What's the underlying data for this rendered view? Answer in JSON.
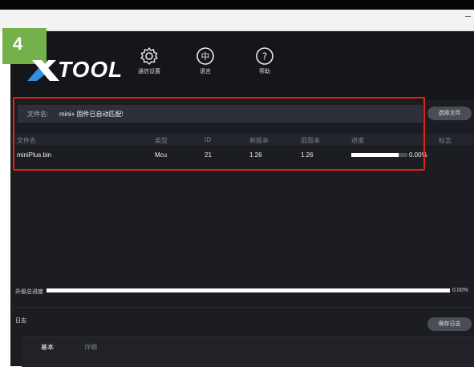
{
  "step_badge": "4",
  "app": {
    "logo_text": "TOOL",
    "toolbar": [
      {
        "label": "通信设置",
        "icon": "gear-icon"
      },
      {
        "label": "语言",
        "icon": "language-icon",
        "glyph": "中"
      },
      {
        "label": "帮助",
        "icon": "help-icon",
        "glyph": "?"
      }
    ]
  },
  "file_bar": {
    "label": "文件名:",
    "value": "mini+ 固件已自动匹配!",
    "select_button": "选择文件"
  },
  "table": {
    "headers": {
      "name": "文件名",
      "type": "类型",
      "id": "ID",
      "new_version": "新版本",
      "old_version": "旧版本",
      "progress": "进度",
      "flag": "标志"
    },
    "rows": [
      {
        "name": "miniPlus.bin",
        "type": "Mcu",
        "id": "21",
        "new_version": "1.26",
        "old_version": "1.26",
        "progress_text": "0.00%",
        "progress_bar_fraction": 0.84
      }
    ]
  },
  "total_progress": {
    "label": "升级总进度",
    "text": "0.00%",
    "bar_fraction": 1.0
  },
  "log": {
    "label": "日志",
    "save_button": "保存日志",
    "tabs": [
      "基本",
      "详细"
    ]
  },
  "colors": {
    "badge": "#74b14a",
    "highlight": "#e0201a",
    "panel": "#1c1d22"
  }
}
